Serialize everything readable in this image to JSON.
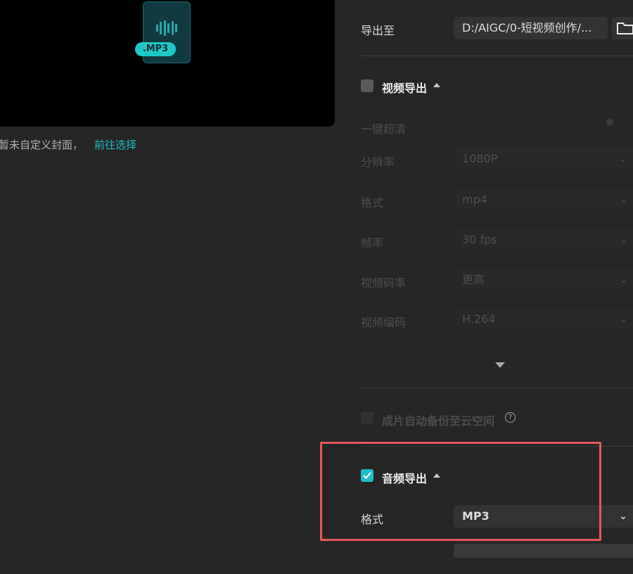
{
  "preview": {
    "badge": ".MP3",
    "cover_text": "暂未自定义封面，",
    "cover_link": "前往选择"
  },
  "export_to": {
    "label": "导出至",
    "path": "D:/AIGC/0-短视频创作/..."
  },
  "video_section": {
    "title": "视频导出",
    "enabled": false,
    "rows": [
      {
        "label": "一键超清",
        "value": ""
      },
      {
        "label": "分辨率",
        "value": "1080P"
      },
      {
        "label": "格式",
        "value": "mp4"
      },
      {
        "label": "帧率",
        "value": "30 fps"
      },
      {
        "label": "视频码率",
        "value": "更高"
      },
      {
        "label": "视频编码",
        "value": "H.264"
      }
    ]
  },
  "cloud_backup": {
    "label": "成片自动备份至云空间",
    "enabled": false
  },
  "audio_section": {
    "title": "音频导出",
    "enabled": true,
    "format_label": "格式",
    "format_value": "MP3"
  },
  "colors": {
    "accent": "#1ec0c8",
    "highlight": "#e8575a",
    "background": "#262626"
  }
}
